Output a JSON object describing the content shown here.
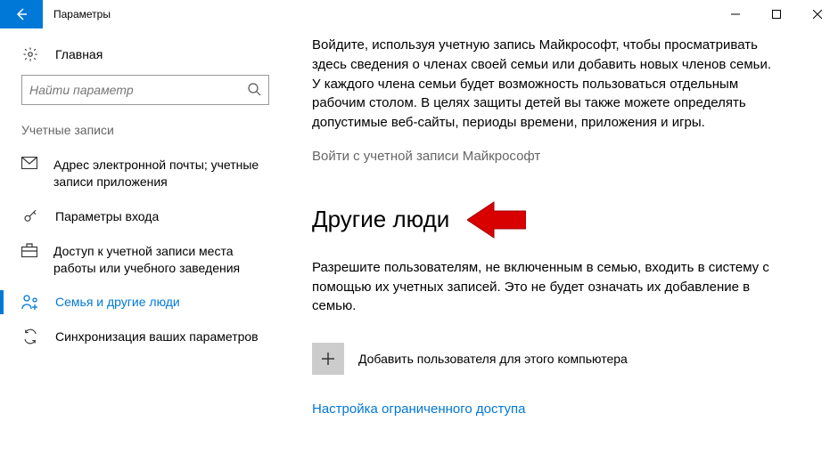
{
  "titlebar": {
    "title": "Параметры"
  },
  "sidebar": {
    "home_label": "Главная",
    "search_placeholder": "Найти параметр",
    "category_label": "Учетные записи",
    "items": [
      {
        "label": "Адрес электронной почты; учетные записи приложения"
      },
      {
        "label": "Параметры входа"
      },
      {
        "label": "Доступ к учетной записи места работы или учебного заведения"
      },
      {
        "label": "Семья и другие люди"
      },
      {
        "label": "Синхронизация ваших параметров"
      }
    ]
  },
  "content": {
    "family_text": "Войдите, используя учетную запись Майкрософт, чтобы просматривать здесь сведения о членах своей семьи или добавить новых членов семьи. У каждого члена семьи будет возможность пользоваться отдельным рабочим столом. В целях защиты детей вы также можете определять допустимые веб-сайты, периоды времени, приложения и игры.",
    "signin_link": "Войти с учетной записи Майкрософт",
    "other_heading": "Другие люди",
    "other_text": "Разрешите пользователям, не включенным в семью, входить в систему с помощью их учетных записей. Это не будет означать их добавление в семью.",
    "add_user_label": "Добавить пользователя для этого компьютера",
    "restricted_link": "Настройка ограниченного доступа"
  }
}
